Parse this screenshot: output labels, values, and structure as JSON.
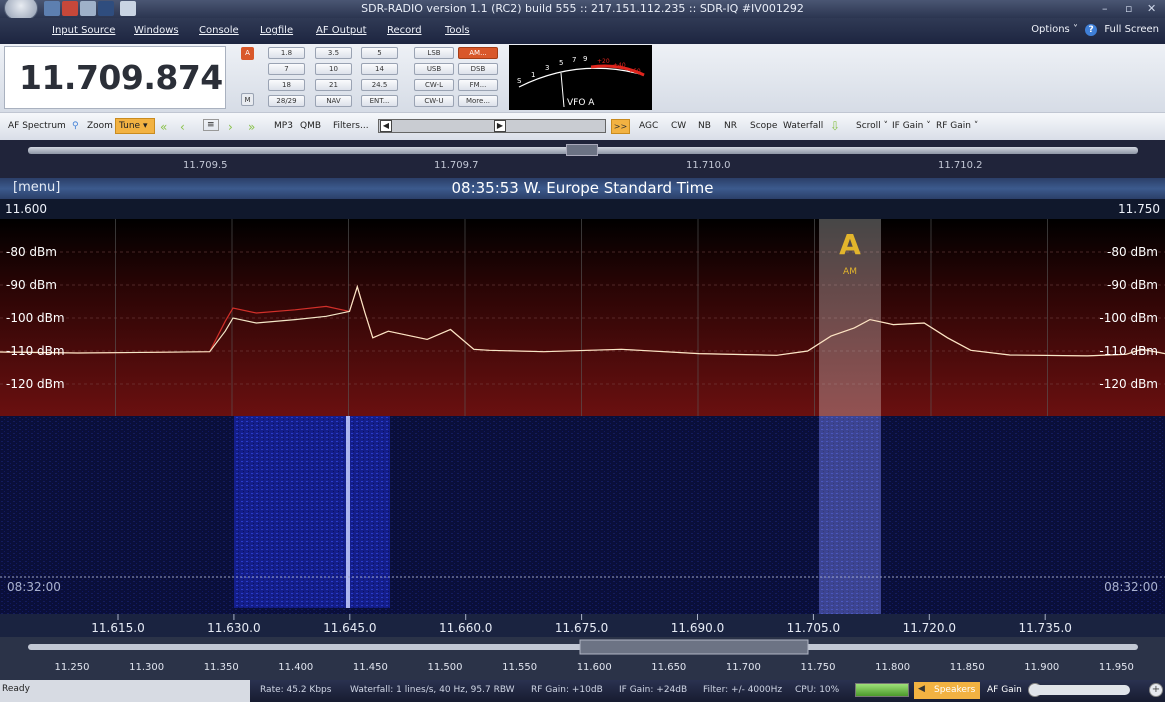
{
  "window": {
    "title": "SDR-RADIO version 1.1 (RC2) build 555 :: 217.151.112.235 :: SDR-IQ #IV001292",
    "controls": [
      "–",
      "▫",
      "✕"
    ]
  },
  "menubar": {
    "items": [
      "Input Source",
      "Windows",
      "Console",
      "Logfile",
      "AF Output",
      "Record",
      "Tools"
    ],
    "options": "Options",
    "fullscreen": "Full Screen"
  },
  "radio": {
    "frequency": "11.709.874",
    "vfo_a_button": "A",
    "memory_button": "M",
    "band_buttons": [
      "1.8",
      "3.5",
      "5",
      "7",
      "10",
      "14",
      "18",
      "21",
      "24.5",
      "28/29",
      "NAV",
      "ENT..."
    ],
    "mode_buttons": [
      "LSB",
      "AM...",
      "USB",
      "DSB",
      "CW-L",
      "FM...",
      "CW-U",
      "More..."
    ],
    "active_mode": "AM...",
    "smeter_label": "VFO A",
    "smeter_scale": [
      "S",
      "1",
      "3",
      "5",
      "7",
      "9",
      "+20",
      "+40",
      "+60"
    ]
  },
  "toolbar": {
    "af_spectrum": "AF Spectrum",
    "zoom": "Zoom",
    "tune": "Tune",
    "mp3": "MP3",
    "qmb": "QMB",
    "filters": "Filters...",
    "go": ">>",
    "agc": "AGC",
    "cw": "CW",
    "nb": "NB",
    "nr": "NR",
    "scope": "Scope",
    "waterfall": "Waterfall",
    "scroll": "Scroll",
    "if_gain": "IF Gain",
    "rf_gain": "RF Gain"
  },
  "fine_ruler": {
    "labels": [
      "11.709.5",
      "11.709.7",
      "11.710.0",
      "11.710.2"
    ]
  },
  "banner": {
    "menu": "[menu]",
    "time": "08:35:53 W. Europe Standard Time"
  },
  "range": {
    "start": "11.600",
    "end": "11.750"
  },
  "spectrum": {
    "y_labels": [
      "-80 dBm",
      "-90 dBm",
      "-100 dBm",
      "-110 dBm",
      "-120 dBm"
    ],
    "y_values": [
      -80,
      -90,
      -100,
      -110,
      -120
    ],
    "marker_letter": "A",
    "marker_mode": "AM",
    "trace_mhz": [
      11.6,
      11.61,
      11.62,
      11.627,
      11.629,
      11.63,
      11.633,
      11.638,
      11.642,
      11.645,
      11.646,
      11.647,
      11.648,
      11.65,
      11.655,
      11.658,
      11.661,
      11.663,
      11.67,
      11.68,
      11.69,
      11.7,
      11.704,
      11.707,
      11.71,
      11.712,
      11.715,
      11.719,
      11.722,
      11.725,
      11.73,
      11.74,
      11.745,
      11.747,
      11.75
    ],
    "trace_dbm": [
      -110.3,
      -110.6,
      -110.4,
      -110.2,
      -104,
      -100,
      -101.5,
      -100.5,
      -99.5,
      -98,
      -90.5,
      -98.5,
      -106,
      -104,
      -106.5,
      -103.5,
      -109.5,
      -109.8,
      -110.2,
      -109.5,
      -110.8,
      -111.3,
      -110,
      -105.5,
      -103,
      -100.5,
      -102,
      -101.5,
      -106,
      -109.8,
      -111.2,
      -111.5,
      -111,
      -109.5,
      -110.8
    ]
  },
  "waterfall": {
    "time_left": "08:32:00",
    "time_right": "08:32:00"
  },
  "axis": {
    "main_labels": [
      "11.615.0",
      "11.630.0",
      "11.645.0",
      "11.660.0",
      "11.675.0",
      "11.690.0",
      "11.705.0",
      "11.720.0",
      "11.735.0"
    ],
    "overview_labels": [
      "11.250",
      "11.300",
      "11.350",
      "11.400",
      "11.450",
      "11.500",
      "11.550",
      "11.600",
      "11.650",
      "11.700",
      "11.750",
      "11.800",
      "11.850",
      "11.900",
      "11.950"
    ]
  },
  "status": {
    "ready": "Ready",
    "rate": "Rate: 45.2 Kbps",
    "waterfall": "Waterfall: 1 lines/s, 40 Hz, 95.7 RBW",
    "rf_gain": "RF Gain: +10dB",
    "if_gain": "IF Gain: +24dB",
    "filter": "Filter: +/- 4000Hz",
    "cpu": "CPU: 10%",
    "speakers": "Speakers",
    "af_gain": "AF Gain"
  },
  "colors": {
    "accent": "#f2b242",
    "trace": "#f4e8c8",
    "spectrum_bg": "#6a1010",
    "waterfall_bg": "#0a0f3a"
  }
}
